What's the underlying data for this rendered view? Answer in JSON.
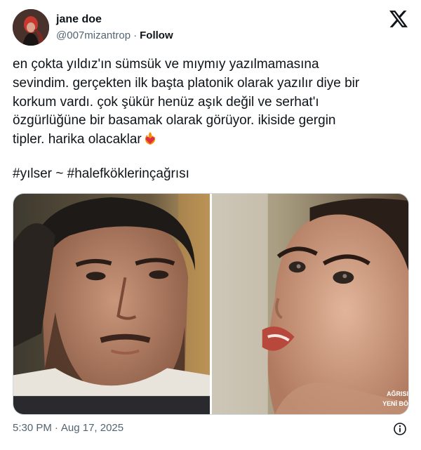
{
  "author": {
    "display_name": "jane doe",
    "handle": "@007mizantrop",
    "separator": "·",
    "follow_label": "Follow"
  },
  "tweet": {
    "lines": [
      "en çokta yıldız'ın sümsük ve mıymıy yazılmamasına",
      "sevindim. gerçekten ilk başta platonik olarak yazılır diye bir",
      "korkum vardı. çok şükür henüz aşık değil ve serhat'ı",
      "özgürlüğüne bir basamak olarak görüyor. ikiside gergin",
      "tipler. harika olacaklar"
    ],
    "emoji": "heart-on-fire",
    "hashtag_1": "#yılser",
    "hashtag_sep": "~",
    "hashtag_2": "#halefköklerinçağrısı"
  },
  "media": {
    "watermark_line1": "AĞRISI",
    "watermark_line2": "YENİ BÖLÜM"
  },
  "meta": {
    "time": "5:30 PM",
    "separator": "·",
    "date": "Aug 17, 2025"
  },
  "colors": {
    "text_primary": "#0f1419",
    "text_secondary": "#536471",
    "border": "#cfd9de"
  }
}
